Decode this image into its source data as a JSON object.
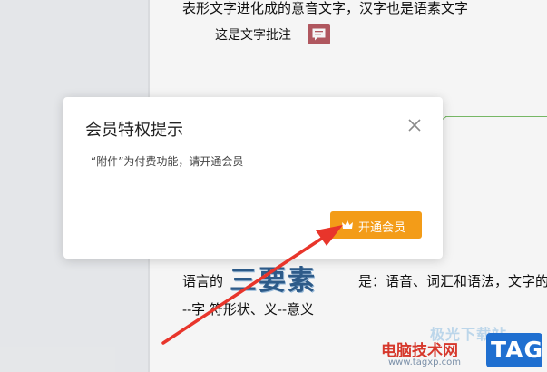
{
  "document": {
    "line1": "表形文字进化成的意音文字，汉字也是语素文字",
    "comment_anchor": "这是文字批注",
    "line_main_prefix": "语言的",
    "big_word": "三要素",
    "line_main_suffix": "是：语音、词汇和语法，文字的",
    "line_last": "--字 符形状、义--意义"
  },
  "dialog": {
    "title": "会员特权提示",
    "message": "“附件”为付费功能，请开通会员",
    "vip_button_label": "开通会员"
  },
  "watermark": {
    "brand_top": "极光下载站",
    "site_name": "电脑技术网",
    "url": "www.tagxp.com",
    "tag": "TAG"
  },
  "colors": {
    "accent_orange": "#f39c18",
    "arrow_red": "#e8352b",
    "comment_icon": "#b85b63"
  }
}
